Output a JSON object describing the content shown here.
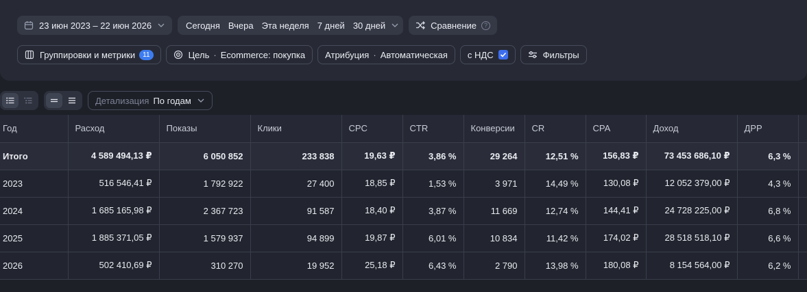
{
  "filters": {
    "date_range": "23 июн 2023 – 22 июн 2026",
    "presets": [
      "Сегодня",
      "Вчера",
      "Эта неделя",
      "7 дней",
      "30 дней"
    ],
    "compare_label": "Сравнение",
    "compare_help": "?",
    "groupings_label": "Группировки и метрики",
    "groupings_count": "11",
    "goal_label": "Цель",
    "goal_value": "Ecommerce: покупка",
    "attribution_label": "Атрибуция",
    "attribution_value": "Автоматическая",
    "vat_label": "с НДС",
    "filters_label": "Фильтры"
  },
  "toolbar": {
    "detail_label": "Детализация",
    "detail_value": "По годам"
  },
  "table": {
    "headers": [
      "Год",
      "Расход",
      "Показы",
      "Клики",
      "CPC",
      "CTR",
      "Конверсии",
      "CR",
      "CPA",
      "Доход",
      "ДРР",
      ""
    ],
    "total": [
      "Итого",
      "4 589 494,13 ₽",
      "6 050 852",
      "233 838",
      "19,63 ₽",
      "3,86 %",
      "29 264",
      "12,51 %",
      "156,83 ₽",
      "73 453 686,10 ₽",
      "6,3 %",
      ""
    ],
    "rows": [
      [
        "2023",
        "516 546,41 ₽",
        "1 792 922",
        "27 400",
        "18,85 ₽",
        "1,53 %",
        "3 971",
        "14,49 %",
        "130,08 ₽",
        "12 052 379,00 ₽",
        "4,3 %",
        ""
      ],
      [
        "2024",
        "1 685 165,98 ₽",
        "2 367 723",
        "91 587",
        "18,40 ₽",
        "3,87 %",
        "11 669",
        "12,74 %",
        "144,41 ₽",
        "24 728 225,00 ₽",
        "6,8 %",
        ""
      ],
      [
        "2025",
        "1 885 371,05 ₽",
        "1 579 937",
        "94 899",
        "19,87 ₽",
        "6,01 %",
        "10 834",
        "11,42 %",
        "174,02 ₽",
        "28 518 518,10 ₽",
        "6,6 %",
        ""
      ],
      [
        "2026",
        "502 410,69 ₽",
        "310 270",
        "19 952",
        "25,18 ₽",
        "6,43 %",
        "2 790",
        "13,98 %",
        "180,08 ₽",
        "8 154 564,00 ₽",
        "6,2 %",
        ""
      ]
    ]
  },
  "colors": {
    "accent": "#3d7cf0",
    "background": "#1e2028",
    "panel": "#272a35"
  }
}
